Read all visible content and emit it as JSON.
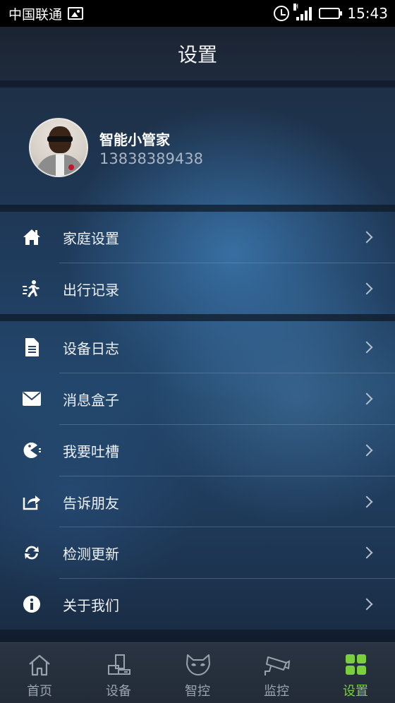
{
  "status_bar": {
    "carrier": "中国联通",
    "time": "15:43",
    "network_type": "H"
  },
  "header": {
    "title": "设置"
  },
  "profile": {
    "name": "智能小管家",
    "phone": "13838389438"
  },
  "menu_groups": [
    {
      "items": [
        {
          "label": "家庭设置",
          "icon": "home-icon"
        },
        {
          "label": "出行记录",
          "icon": "running-person-icon"
        }
      ]
    },
    {
      "items": [
        {
          "label": "设备日志",
          "icon": "document-icon"
        },
        {
          "label": "消息盒子",
          "icon": "envelope-icon"
        },
        {
          "label": "我要吐槽",
          "icon": "pacman-icon"
        },
        {
          "label": "告诉朋友",
          "icon": "share-icon"
        },
        {
          "label": "检测更新",
          "icon": "refresh-icon"
        },
        {
          "label": "关于我们",
          "icon": "info-icon"
        }
      ]
    }
  ],
  "bottom_nav": {
    "items": [
      {
        "label": "首页",
        "icon": "home-outline-icon"
      },
      {
        "label": "设备",
        "icon": "devices-icon"
      },
      {
        "label": "智控",
        "icon": "cat-mask-icon"
      },
      {
        "label": "监控",
        "icon": "camera-icon"
      },
      {
        "label": "设置",
        "icon": "grid-icon",
        "active": true
      }
    ]
  },
  "colors": {
    "active_tab": "#7ccf3c",
    "inactive_tab": "#9aa3ad",
    "status_bar_bg": "#000000"
  }
}
